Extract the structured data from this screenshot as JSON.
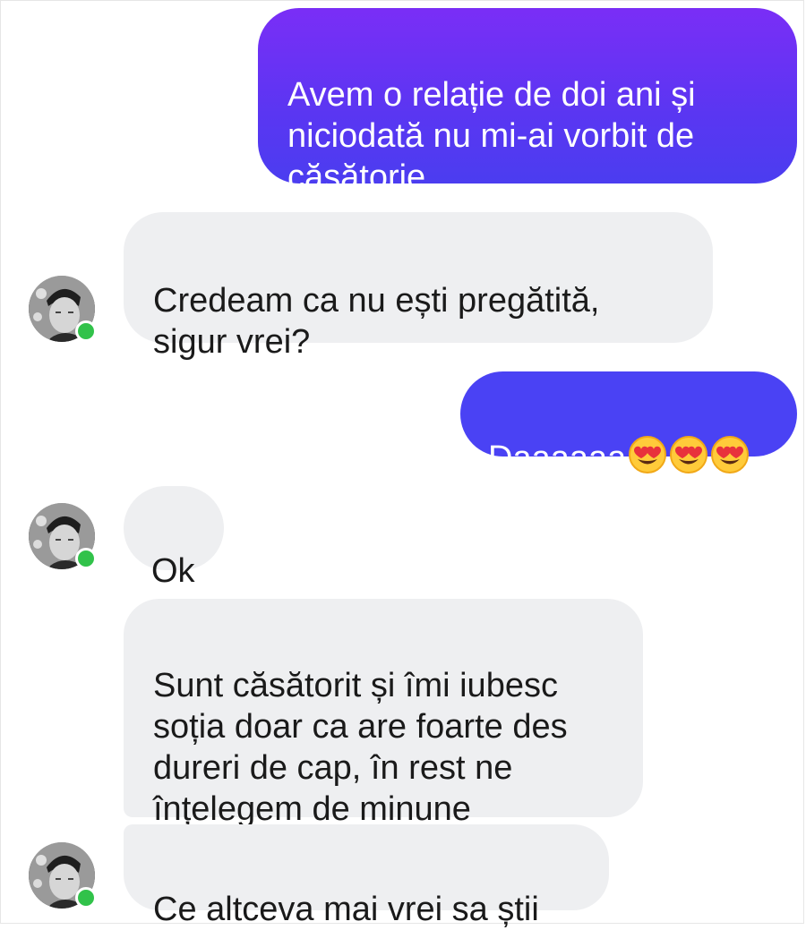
{
  "conversation": {
    "messages": [
      {
        "sender": "me",
        "text": "Avem o relație de doi ani și\nniciodată nu mi-ai vorbit de\ncăsătorie"
      },
      {
        "sender": "contact",
        "text": "Credeam ca nu ești pregătită,\nsigur vrei?"
      },
      {
        "sender": "me",
        "text": "Daaaaaa"
      },
      {
        "sender": "contact",
        "text": "Ok"
      },
      {
        "sender": "contact",
        "text": "Sunt căsătorit și îmi iubesc\nsoția doar ca are foarte des\ndureri de cap, în rest ne\nînțelegem de minune"
      },
      {
        "sender": "contact",
        "text": "Ce altceva mai vrei sa știi"
      }
    ],
    "emoji_after_msg_2": [
      "smiling-face-with-heart-eyes",
      "smiling-face-with-heart-eyes",
      "smiling-face-with-heart-eyes"
    ]
  },
  "colors": {
    "outgoing_gradient_top": "#7b2ff7",
    "outgoing_gradient_bottom": "#3d3ff0",
    "outgoing_single": "#4a42f4",
    "incoming_bg": "#eeeff1",
    "online": "#31c24a"
  }
}
